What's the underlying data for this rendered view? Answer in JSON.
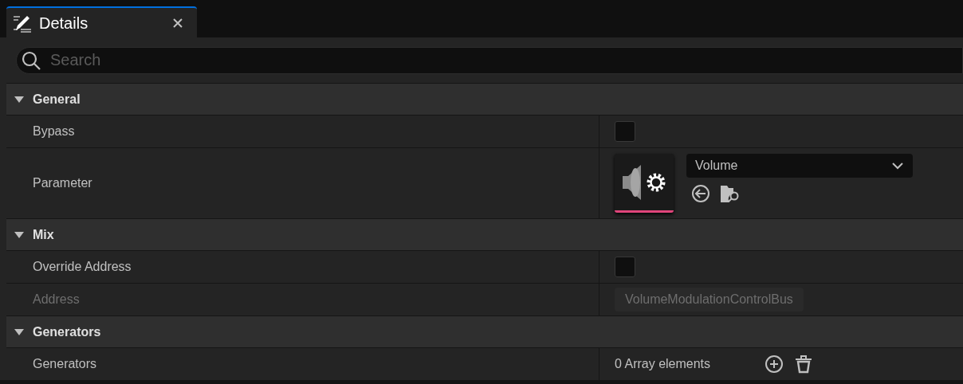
{
  "tab": {
    "title": "Details",
    "selected": true
  },
  "search": {
    "placeholder": "Search"
  },
  "sections": [
    {
      "title": "General",
      "expanded": true,
      "rows": [
        {
          "kind": "checkbox",
          "label": "Bypass",
          "checked": false,
          "disabled": false
        },
        {
          "kind": "asset",
          "label": "Parameter",
          "value": "Volume",
          "disabled": false,
          "color": "#e0457b"
        }
      ]
    },
    {
      "title": "Mix",
      "expanded": true,
      "rows": [
        {
          "kind": "checkbox",
          "label": "Override Address",
          "checked": false,
          "disabled": false
        },
        {
          "kind": "text",
          "label": "Address",
          "value": "VolumeModulationControlBus",
          "disabled": true
        }
      ]
    },
    {
      "title": "Generators",
      "expanded": true,
      "rows": [
        {
          "kind": "array",
          "label": "Generators",
          "value": "0 Array elements",
          "disabled": false
        }
      ]
    }
  ]
}
